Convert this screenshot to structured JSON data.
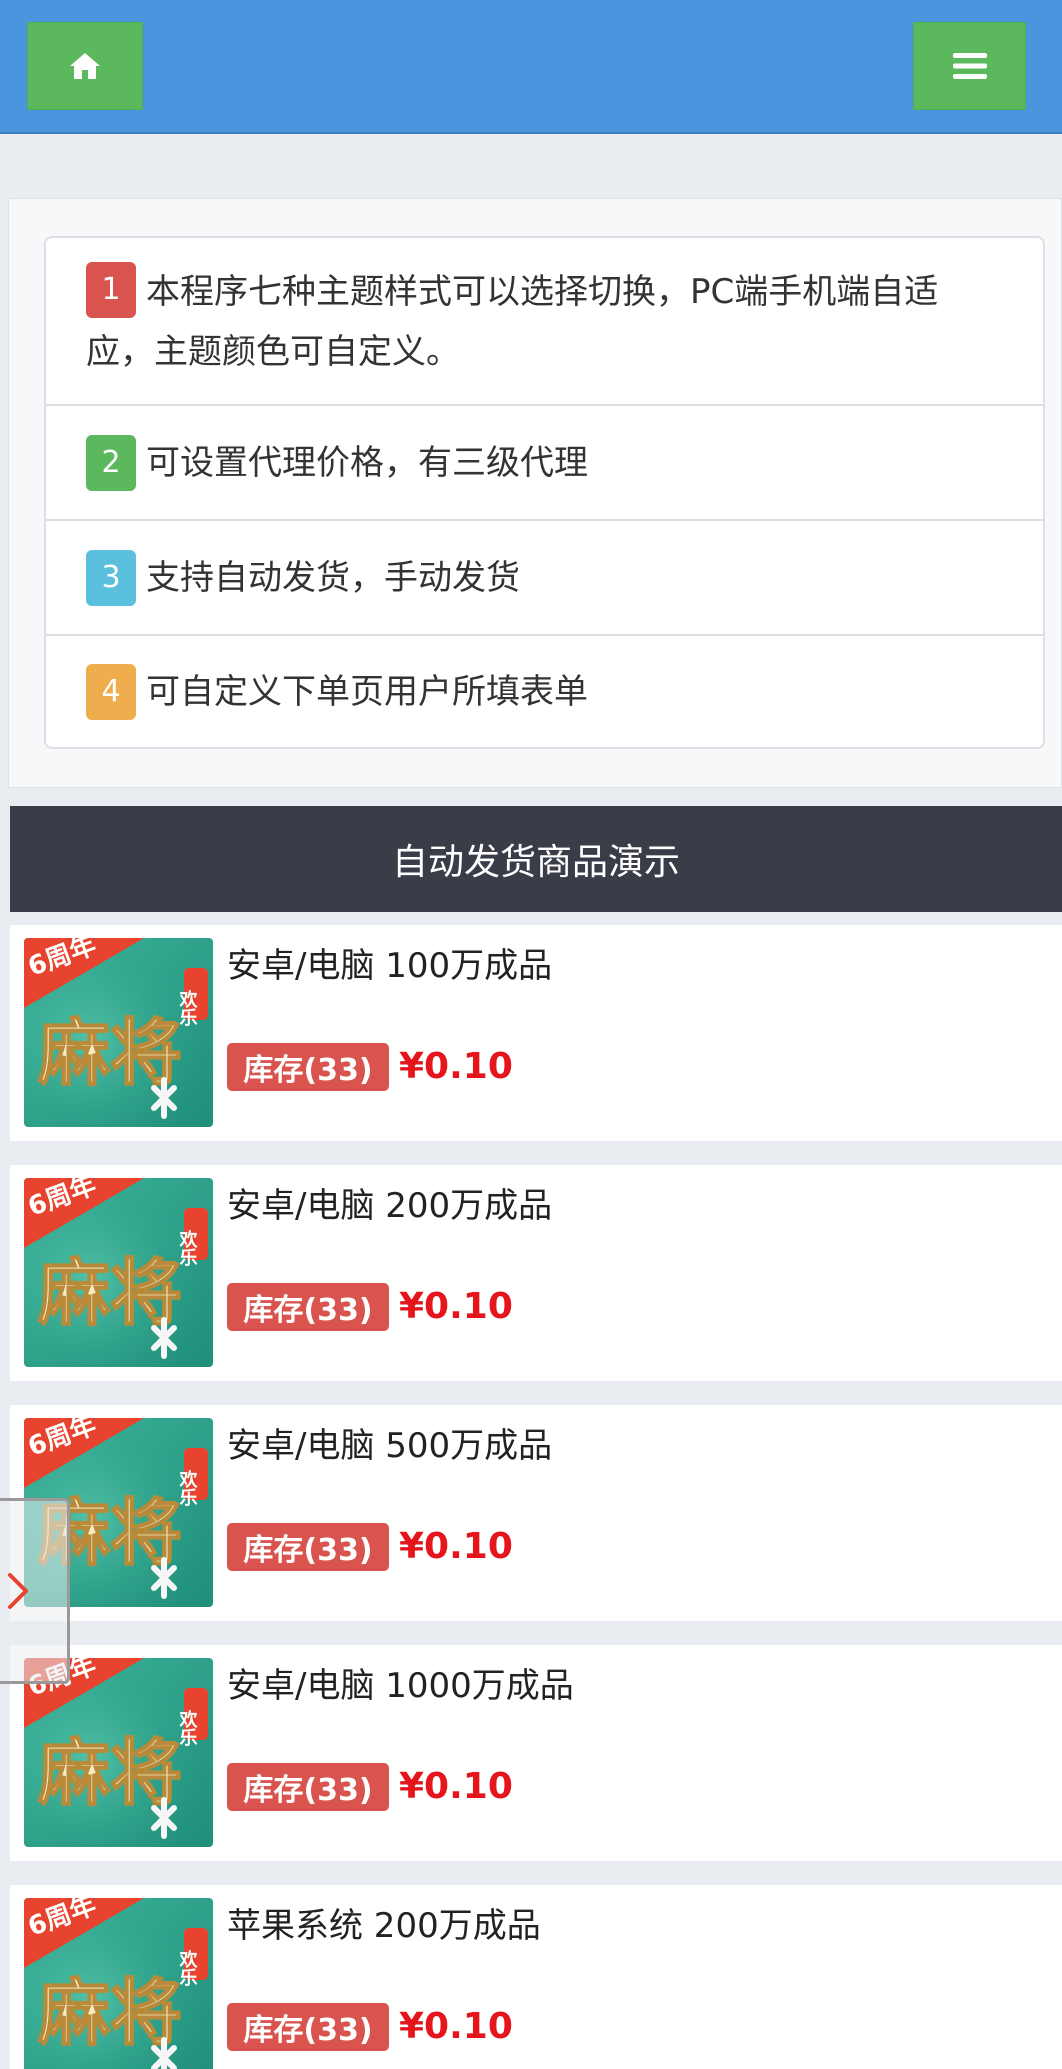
{
  "header": {
    "home_icon": "home-icon",
    "menu_icon": "hamburger-menu-icon",
    "accent_color": "#4a95dd",
    "button_color": "#5cb85c"
  },
  "notices": [
    {
      "num": "1",
      "text": "本程序七种主题样式可以选择切换，PC端手机端自适应，主题颜色可自定义。",
      "color": "#d9534f"
    },
    {
      "num": "2",
      "text": "可设置代理价格，有三级代理",
      "color": "#5cb85c"
    },
    {
      "num": "3",
      "text": "支持自动发货，手动发货",
      "color": "#5bc0de"
    },
    {
      "num": "4",
      "text": "可自定义下单页用户所填表单",
      "color": "#f0ad4e"
    }
  ],
  "section": {
    "title": "自动发货商品演示"
  },
  "products": [
    {
      "name": "安卓/电脑 100万成品",
      "stock": "库存(33)",
      "price": "¥0.10"
    },
    {
      "name": "安卓/电脑 200万成品",
      "stock": "库存(33)",
      "price": "¥0.10"
    },
    {
      "name": "安卓/电脑 500万成品",
      "stock": "库存(33)",
      "price": "¥0.10"
    },
    {
      "name": "安卓/电脑 1000万成品",
      "stock": "库存(33)",
      "price": "¥0.10"
    },
    {
      "name": "苹果系统 200万成品",
      "stock": "库存(33)",
      "price": "¥0.10"
    }
  ],
  "thumbnail": {
    "badge": "6周年",
    "title": "麻将",
    "sub": "欢乐"
  },
  "side_tab": {
    "icon": "chevron-right-icon"
  }
}
